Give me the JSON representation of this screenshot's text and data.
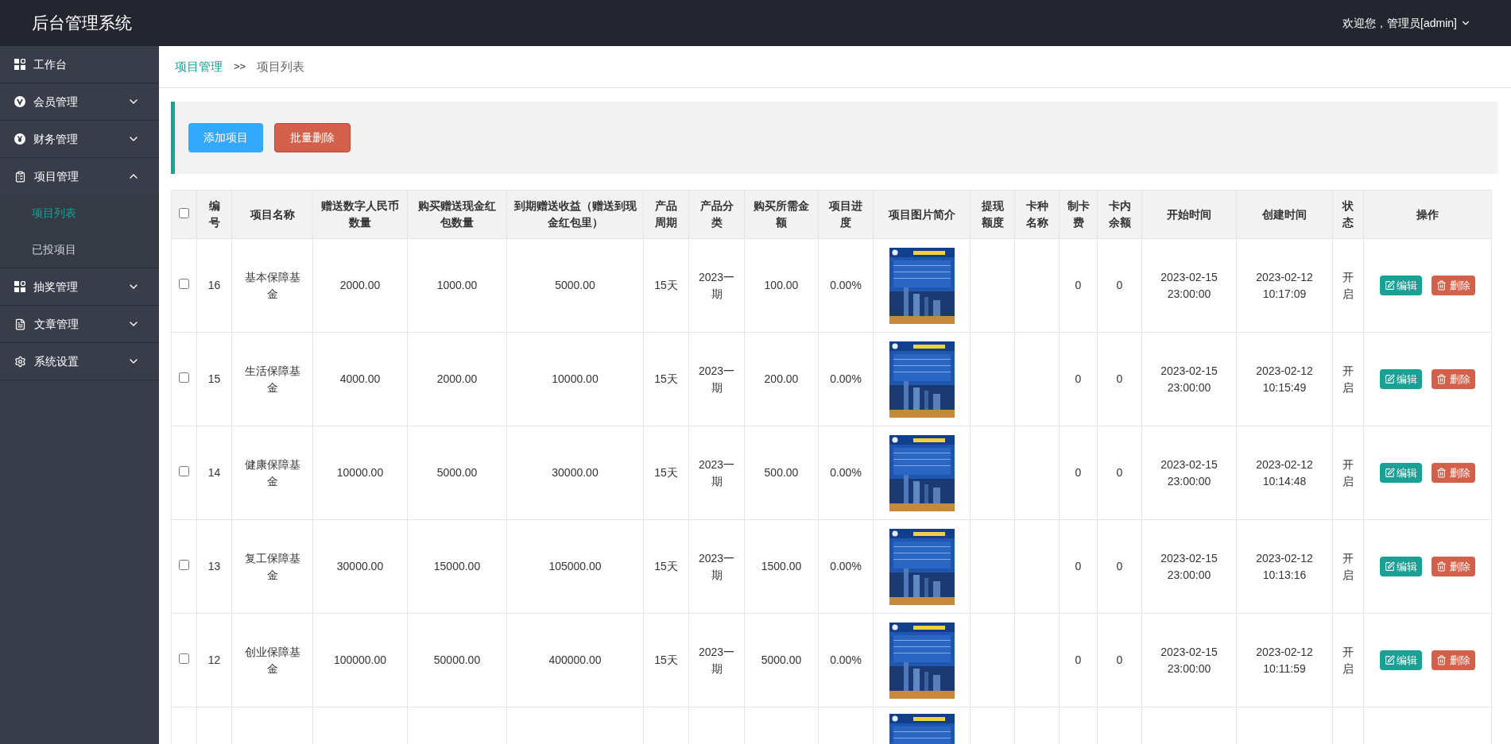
{
  "header": {
    "title": "后台管理系统",
    "user_menu": "欢迎您，管理员[admin]"
  },
  "sidebar": {
    "items": [
      {
        "kind": "dashboard",
        "label": "工作台"
      },
      {
        "kind": "vip",
        "label": "会员管理",
        "expanded": false
      },
      {
        "kind": "yen",
        "label": "财务管理",
        "expanded": false
      },
      {
        "kind": "clipboard",
        "label": "项目管理",
        "expanded": true,
        "children": [
          {
            "label": "项目列表",
            "selected": true
          },
          {
            "label": "已投项目",
            "selected": false
          }
        ]
      },
      {
        "kind": "dashboard",
        "label": "抽奖管理",
        "expanded": false
      },
      {
        "kind": "file",
        "label": "文章管理",
        "expanded": false
      },
      {
        "kind": "gear",
        "label": "系统设置",
        "expanded": false
      }
    ]
  },
  "breadcrumb": [
    "项目管理",
    "项目列表"
  ],
  "breadcrumb_separator": ">>",
  "toolbar": [
    {
      "kind": "primary",
      "label": "添加项目"
    },
    {
      "kind": "danger",
      "label": "批量删除"
    }
  ],
  "table": {
    "select_all": false,
    "columns": [
      "编号",
      "项目名称",
      "赠送数字人民币数量",
      "购买赠送现金红包数量",
      "到期赠送收益（赠送到现金红包里）",
      "产品周期",
      "产品分类",
      "购买所需金额",
      "项目进度",
      "项目图片简介",
      "提现额度",
      "卡种名称",
      "制卡费",
      "卡内余额",
      "开始时间",
      "创建时间",
      "状态",
      "操作"
    ],
    "rows": [
      {
        "checked": false,
        "id": "16",
        "name": "基本保障基金",
        "gift_rmb": "2000.00",
        "gift_cash": "1000.00",
        "reward": "5000.00",
        "period": "15天",
        "category": "2023一期",
        "price": "100.00",
        "progress": "0.00%",
        "card_fee": "0",
        "balance": "0",
        "start": "2023-02-15 23:00:00",
        "created": "2023-02-12 10:17:09",
        "status": "开启",
        "edit": "编辑",
        "delete": "删除"
      },
      {
        "checked": false,
        "id": "15",
        "name": "生活保障基金",
        "gift_rmb": "4000.00",
        "gift_cash": "2000.00",
        "reward": "10000.00",
        "period": "15天",
        "category": "2023一期",
        "price": "200.00",
        "progress": "0.00%",
        "card_fee": "0",
        "balance": "0",
        "start": "2023-02-15 23:00:00",
        "created": "2023-02-12 10:15:49",
        "status": "开启",
        "edit": "编辑",
        "delete": "删除"
      },
      {
        "checked": false,
        "id": "14",
        "name": "健康保障基金",
        "gift_rmb": "10000.00",
        "gift_cash": "5000.00",
        "reward": "30000.00",
        "period": "15天",
        "category": "2023一期",
        "price": "500.00",
        "progress": "0.00%",
        "card_fee": "0",
        "balance": "0",
        "start": "2023-02-15 23:00:00",
        "created": "2023-02-12 10:14:48",
        "status": "开启",
        "edit": "编辑",
        "delete": "删除"
      },
      {
        "checked": false,
        "id": "13",
        "name": "复工保障基金",
        "gift_rmb": "30000.00",
        "gift_cash": "15000.00",
        "reward": "105000.00",
        "period": "15天",
        "category": "2023一期",
        "price": "1500.00",
        "progress": "0.00%",
        "card_fee": "0",
        "balance": "0",
        "start": "2023-02-15 23:00:00",
        "created": "2023-02-12 10:13:16",
        "status": "开启",
        "edit": "编辑",
        "delete": "删除"
      },
      {
        "checked": false,
        "id": "12",
        "name": "创业保障基金",
        "gift_rmb": "100000.00",
        "gift_cash": "50000.00",
        "reward": "400000.00",
        "period": "15天",
        "category": "2023一期",
        "price": "5000.00",
        "progress": "0.00%",
        "card_fee": "0",
        "balance": "0",
        "start": "2023-02-15 23:00:00",
        "created": "2023-02-12 10:11:59",
        "status": "开启",
        "edit": "编辑",
        "delete": "删除"
      },
      {
        "kind": "cut"
      }
    ]
  }
}
